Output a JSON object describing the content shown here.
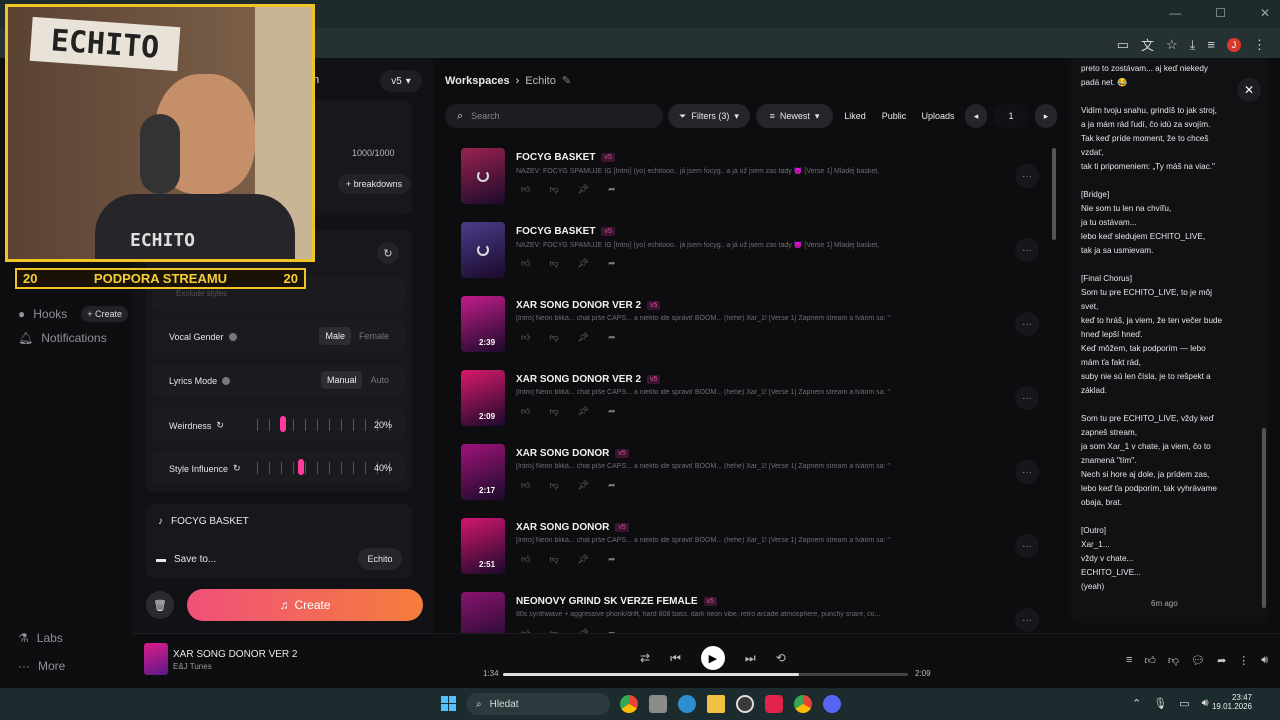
{
  "browser": {
    "window_controls": [
      "—",
      "☐",
      "✕"
    ],
    "profile_initial": "J"
  },
  "nav": {
    "hooks": "Hooks",
    "create": "+ Create",
    "notifications": "Notifications",
    "labs": "Labs",
    "more": "More"
  },
  "create_panel": {
    "model_tab_suffix": "m",
    "version": "v5",
    "char_count": "1000/1000",
    "tag_suffix": "s",
    "breakdowns": "+  breakdowns",
    "exclude_placeholder": "Exclude styles",
    "vocal_gender": {
      "label": "Vocal Gender",
      "options": [
        "Male",
        "Female"
      ],
      "selected": "Male"
    },
    "lyrics_mode": {
      "label": "Lyrics Mode",
      "options": [
        "Manual",
        "Auto"
      ],
      "selected": "Manual"
    },
    "weirdness": {
      "label": "Weirdness",
      "value": "20%",
      "level": 0.2
    },
    "style_influence": {
      "label": "Style Influence",
      "value": "40%",
      "level": 0.4
    },
    "song_title": "FOCYG BASKET",
    "save_to": "Save to...",
    "workspace": "Echito",
    "create_label": "Create"
  },
  "library": {
    "breadcrumb": {
      "root": "Workspaces",
      "current": "Echito"
    },
    "search_placeholder": "Search",
    "filters": "Filters (3)",
    "sort": "Newest",
    "liked": "Liked",
    "public": "Public",
    "uploads": "Uploads",
    "page": "1",
    "songs": [
      {
        "title": "FOCYG BASKET",
        "version": "v5",
        "lyrics": "NAZEV: FOCYG SPAMUJE IG [Intro] (yo) echitooo.. já jsem focyg.. a já už jsem zas tady 😈 [Verse 1] Mladej basket,",
        "duration": "",
        "loading": true,
        "color": "#9b2350"
      },
      {
        "title": "FOCYG BASKET",
        "version": "v5",
        "lyrics": "NAZEV: FOCYG SPAMUJE IG [Intro] (yo) echitooo.. já jsem focyg.. a já už jsem zas tady 😈 [Verse 1] Mladej basket,",
        "duration": "",
        "loading": true,
        "color": "#4a3c8a"
      },
      {
        "title": "XAR SONG DONOR VER 2",
        "version": "v5",
        "lyrics": "[Intro] Neón bliká... chat píše CAPS... a niekto ide spraviť BOOM... (hehe) Xar_1! [Verse 1] Zapnem stream a tvárim sa: \"",
        "duration": "2:39",
        "loading": false,
        "color": "#c21d8a"
      },
      {
        "title": "XAR SONG DONOR VER 2",
        "version": "v5",
        "lyrics": "[Intro] Neón bliká... chat píše CAPS... a niekto ide spraviť BOOM... (hehe) Xar_1! [Verse 1] Zapnem stream a tvárim sa: \"",
        "duration": "2:09",
        "loading": false,
        "color": "#d91a6c"
      },
      {
        "title": "XAR SONG DONOR",
        "version": "v5",
        "lyrics": "[Intro] Neón bliká... chat píše CAPS... a niekto ide spraviť BOOM... (hehe) Xar_1! [Verse 1] Zapnem stream a tvárim sa: \"",
        "duration": "2:17",
        "loading": false,
        "color": "#a0137a"
      },
      {
        "title": "XAR SONG DONOR",
        "version": "v5",
        "lyrics": "[Intro] Neón bliká... chat píše CAPS... a niekto ide spraviť BOOM... (hehe) Xar_1! [Verse 1] Zapnem stream a tvárim sa: \"",
        "duration": "2:51",
        "loading": false,
        "color": "#d41670"
      },
      {
        "title": "NEONOVY GRIND SK VERZE FEMALE",
        "version": "v5",
        "lyrics": "80s synthwave + aggressive phonk/drift, hard 808 bass, dark neon vibe, retro arcade atmosphere, punchy snare, co...",
        "duration": "",
        "loading": false,
        "color": "#8a1470"
      }
    ]
  },
  "lyrics_panel": {
    "text": "preto to zostávam... aj keď niekedy\npadá net. 😂\n\nVidím tvoju snahu, grindíš to jak stroj,\na ja mám rád ľudí, čo idú za svojím.\nTak keď príde moment, že to chceš\nvzdať,\ntak ti pripomeniem: „Ty máš na viac.\"\n\n[Bridge]\nNie som tu len na chvíľu,\nja tu ostávam...\nlebo keď sledujem ECHITO_LIVE,\ntak ja sa usmievam.\n\n[Final Chorus]\nSom tu pre ECHITO_LIVE, to je môj\nsvet,\nkeď to hráš, ja viem, že ten večer bude\nhneď lepší hneď.\nKeď môžem, tak podporím — lebo\nmám ťa fakt rád,\nsuby nie sú len čísla, je to rešpekt a\nzáklad.\n\nSom tu pre ECHITO_LIVE, vždy keď\nzapneš stream,\nja som Xar_1 v chate, ja viem, čo to\nznamená \"tím\".\nNech si hore aj dole, ja prídem zas,\nlebo keď ťa podporím, tak vyhrávame\nobaja, brat.\n\n[Outro]\nXar_1...\nvždy v chate...\nECHITO_LIVE...\n(yeah)",
    "time": "6m ago"
  },
  "player": {
    "title": "XAR SONG DONOR VER 2",
    "artist": "E&J Tunes",
    "elapsed": "1:34",
    "total": "2:09",
    "progress": 0.73
  },
  "taskbar": {
    "search": "Hledat",
    "time": "23:47",
    "date": "19.01.2026"
  },
  "overlay": {
    "cam_brand": "ECHITO",
    "shirt": "ECHITO",
    "donor_left": "20",
    "donor_text": "PODPORA STREAMU",
    "donor_right": "20"
  }
}
